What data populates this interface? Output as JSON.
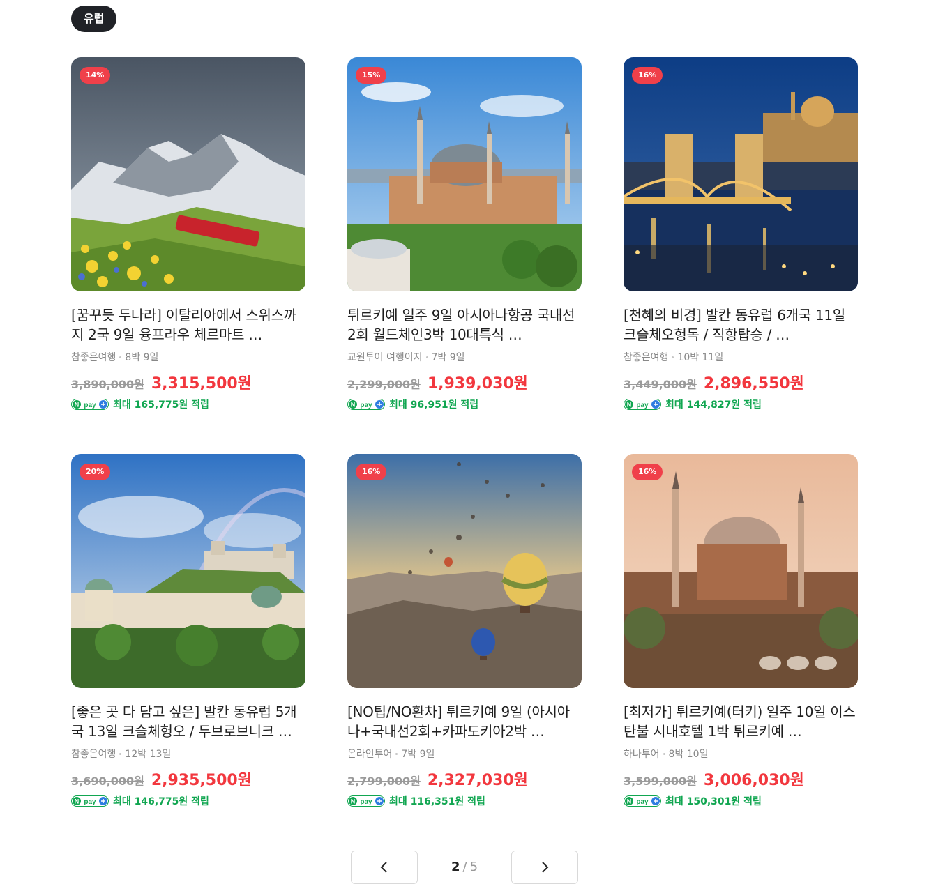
{
  "region_chip": "유럽",
  "products": [
    {
      "discount": "14%",
      "title": "[꿈꾸듯 두나라] 이탈리아에서 스위스까지 2국 9일 융프라우 체르마트 …",
      "agency": "참좋은여행",
      "duration": "8박 9일",
      "original_price": "3,890,000원",
      "sale_price": "3,315,500원",
      "npay_label": "최대 165,775원 적립",
      "image": "alps-train"
    },
    {
      "discount": "15%",
      "title": "튀르키예 일주 9일 아시아나항공 국내선 2회 월드체인3박 10대특식 …",
      "agency": "교원투어 여행이지",
      "duration": "7박 9일",
      "original_price": "2,299,000원",
      "sale_price": "1,939,030원",
      "npay_label": "최대 96,951원 적립",
      "image": "hagia-sophia-day"
    },
    {
      "discount": "16%",
      "title": "[천혜의 비경] 발칸 동유럽 6개국 11일 크슬체오헝독 / 직항탑승 / …",
      "agency": "참좋은여행",
      "duration": "10박 11일",
      "original_price": "3,449,000원",
      "sale_price": "2,896,550원",
      "npay_label": "최대 144,827원 적립",
      "image": "budapest-chain-bridge"
    },
    {
      "discount": "20%",
      "title": "[좋은 곳 다 담고 싶은] 발칸 동유럽 5개국 13일 크슬체헝오 / 두브로브니크 …",
      "agency": "참좋은여행",
      "duration": "12박 13일",
      "original_price": "3,690,000원",
      "sale_price": "2,935,500원",
      "npay_label": "최대 146,775원 적립",
      "image": "salzburg-castle"
    },
    {
      "discount": "16%",
      "title": "[NO팁/NO환차] 튀르키예 9일 (아시아나+국내선2회+카파도키아2박 …",
      "agency": "온라인투어",
      "duration": "7박 9일",
      "original_price": "2,799,000원",
      "sale_price": "2,327,030원",
      "npay_label": "최대 116,351원 적립",
      "image": "cappadocia-balloons"
    },
    {
      "discount": "16%",
      "title": "[최저가] 튀르키예(터키) 일주 10일 이스탄불 시내호텔 1박 튀르키예 …",
      "agency": "하나투어",
      "duration": "8박 10일",
      "original_price": "3,599,000원",
      "sale_price": "3,006,030원",
      "npay_label": "최대 150,301원 적립",
      "image": "hagia-sophia-sunset"
    }
  ],
  "npay_badge": "pay",
  "pagination": {
    "current": "2",
    "separator": "/",
    "total": "5"
  },
  "colors": {
    "discount": "#f0404a",
    "sale": "#f2373e",
    "npay": "#11a651",
    "chip": "#202227"
  }
}
